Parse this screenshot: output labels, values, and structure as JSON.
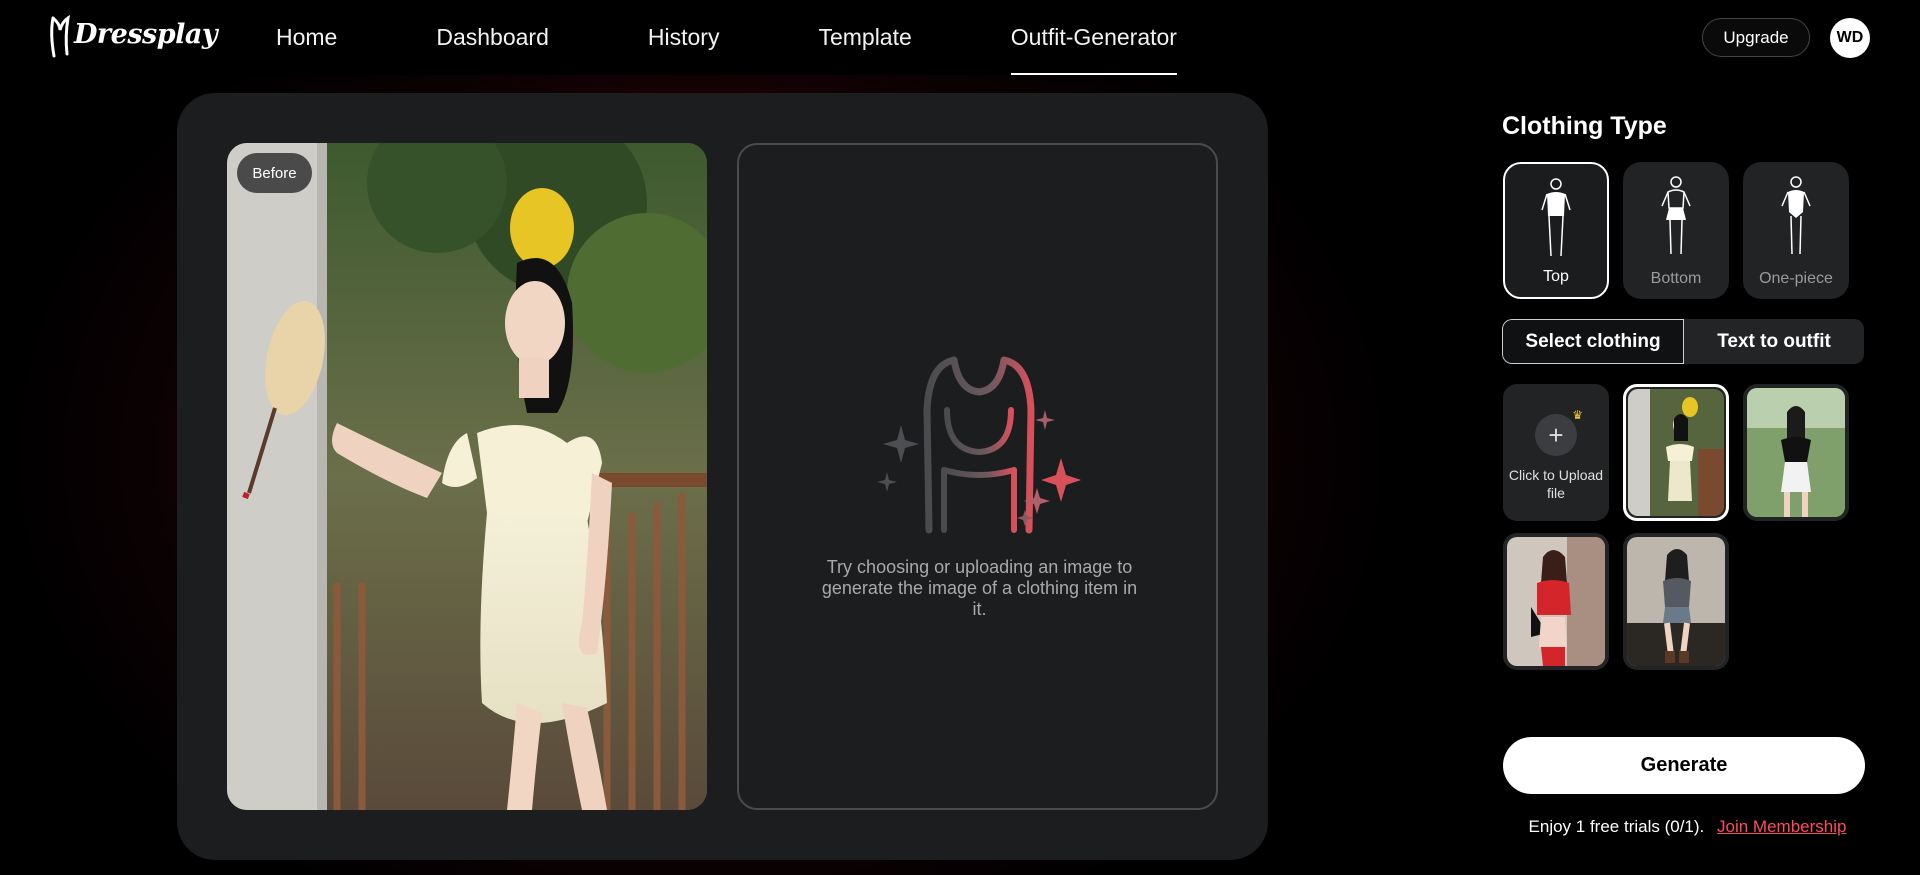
{
  "header": {
    "logo_text": "Dressplay",
    "nav": [
      {
        "label": "Home"
      },
      {
        "label": "Dashboard"
      },
      {
        "label": "History"
      },
      {
        "label": "Template"
      },
      {
        "label": "Outfit-Generator",
        "active": true
      }
    ],
    "upgrade_label": "Upgrade",
    "avatar_initials": "WD"
  },
  "main": {
    "before_badge": "Before",
    "placeholder_text": "Try choosing or uploading an image to generate the image of a clothing item in it."
  },
  "side": {
    "title": "Clothing Type",
    "types": [
      {
        "label": "Top",
        "selected": true
      },
      {
        "label": "Bottom"
      },
      {
        "label": "One-piece"
      }
    ],
    "tabs": [
      {
        "label": "Select clothing",
        "active": true
      },
      {
        "label": "Text to outfit"
      }
    ],
    "upload_label": "Click to Upload file",
    "generate_label": "Generate",
    "trial_text": "Enjoy 1 free trials (0/1).",
    "membership_link": "Join Membership"
  },
  "colors": {
    "accent": "#ff4b5c",
    "panel": "#1c1d1f",
    "background_glow": "#6a0010"
  },
  "icons": [
    "plus-icon",
    "crown-icon",
    "top-silhouette-icon",
    "bottom-silhouette-icon",
    "one-piece-silhouette-icon",
    "clothing-sparkle-icon"
  ]
}
